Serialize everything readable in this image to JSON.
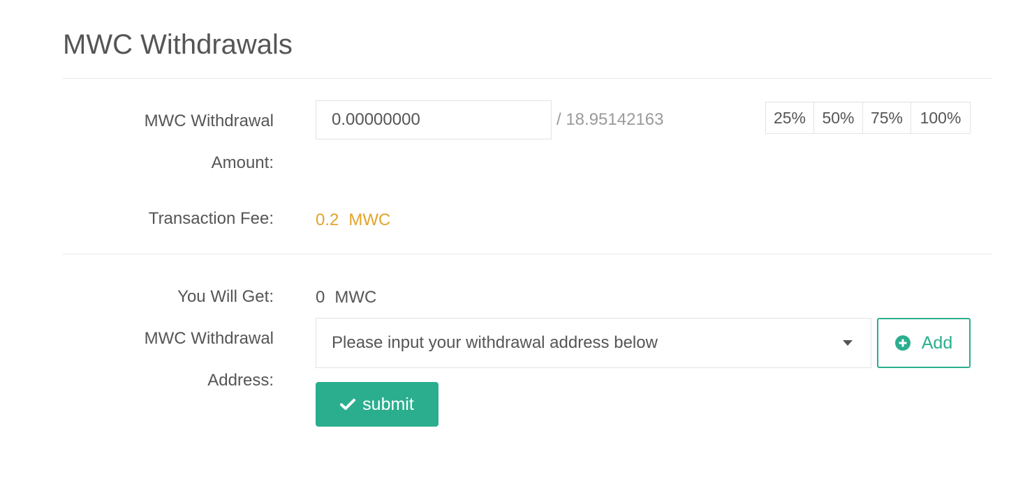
{
  "page": {
    "title": "MWC Withdrawals"
  },
  "amount": {
    "label_line1": "MWC Withdrawal",
    "label_line2": "Amount:",
    "value": "0.00000000",
    "balance": "/ 18.95142163",
    "percent_buttons": [
      "25%",
      "50%",
      "75%",
      "100%"
    ]
  },
  "fee": {
    "label": "Transaction Fee:",
    "value": "0.2",
    "unit": "MWC"
  },
  "receive": {
    "label": "You Will Get:",
    "value": "0",
    "unit": "MWC"
  },
  "address": {
    "label_line1": "MWC Withdrawal",
    "label_line2": "Address:",
    "placeholder": "Please input your withdrawal address below",
    "add_label": "Add"
  },
  "submit": {
    "label": "submit"
  },
  "colors": {
    "accent": "#2aae8e",
    "fee": "#e0a52b",
    "text": "#555555",
    "muted": "#9a9a9a"
  },
  "icons": {
    "add": "plus-circle-icon",
    "submit": "check-icon",
    "dropdown": "chevron-down-icon"
  }
}
